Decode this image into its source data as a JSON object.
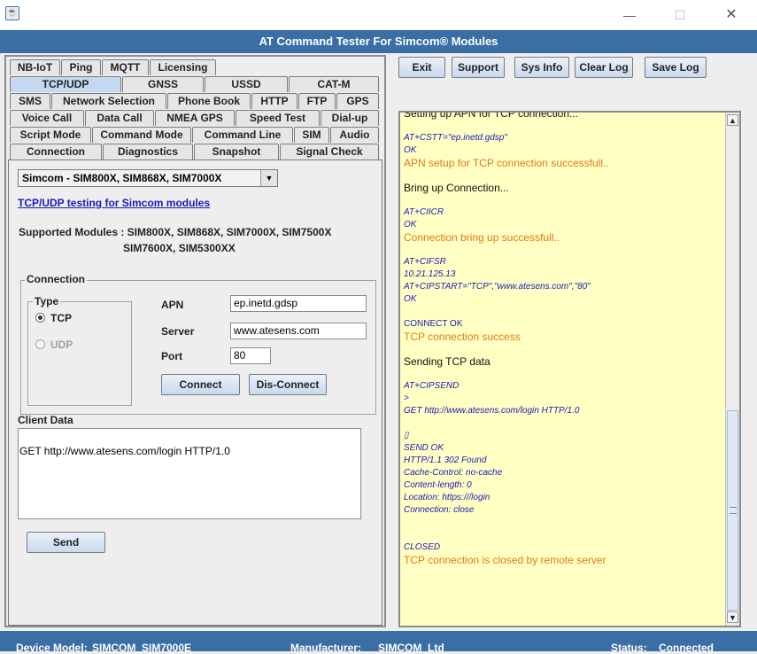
{
  "window": {
    "title": "AT Command Tester For Simcom® Modules",
    "minimize_glyph": "—",
    "maximize_glyph": "☐",
    "close_glyph": "✕"
  },
  "tabs": {
    "row1": [
      "NB-IoT",
      "Ping",
      "MQTT",
      "Licensing"
    ],
    "row2": [
      "TCP/UDP",
      "GNSS",
      "USSD",
      "CAT-M"
    ],
    "row3": [
      "SMS",
      "Network Selection",
      "Phone Book",
      "HTTP",
      "FTP",
      "GPS"
    ],
    "row4": [
      "Voice Call",
      "Data Call",
      "NMEA GPS",
      "Speed Test",
      "Dial-up"
    ],
    "row5": [
      "Script Mode",
      "Command Mode",
      "Command Line",
      "SIM",
      "Audio"
    ],
    "row6": [
      "Connection",
      "Diagnostics",
      "Snapshot",
      "Signal Check"
    ],
    "selected": "TCP/UDP"
  },
  "module_select": {
    "value": "Simcom - SIM800X, SIM868X, SIM7000X",
    "arrow": "▼"
  },
  "tcp_link": "TCP/UDP testing for Simcom modules",
  "supported": {
    "line1": "Supported Modules : SIM800X, SIM868X, SIM7000X, SIM7500X",
    "line2": "SIM7600X, SIM5300XX"
  },
  "connection": {
    "title": "Connection",
    "type_title": "Type",
    "radio_tcp": "TCP",
    "radio_udp": "UDP",
    "apn_label": "APN",
    "apn_value": "ep.inetd.gdsp",
    "server_label": "Server",
    "server_value": "www.atesens.com",
    "port_label": "Port",
    "port_value": "80",
    "connect_button": "Connect",
    "disconnect_button": "Dis-Connect"
  },
  "client_data": {
    "label": "Client Data",
    "value": "GET http://www.atesens.com/login HTTP/1.0",
    "send_button": "Send"
  },
  "toolbar": {
    "exit": "Exit",
    "support": "Support",
    "sysinfo": "Sys Info",
    "clearlog": "Clear Log",
    "savelog": "Save Log"
  },
  "log": {
    "lines": [
      {
        "t": "Setting up APN for TCP connection...",
        "s": "black"
      },
      {
        "t": "",
        "s": "black"
      },
      {
        "t": "AT+CSTT=\"ep.inetd.gdsp\"",
        "s": "cmd"
      },
      {
        "t": "OK",
        "s": "cmd"
      },
      {
        "t": "APN setup for TCP connection successfull..",
        "s": "orange"
      },
      {
        "t": "",
        "s": "black"
      },
      {
        "t": "Bring up Connection...",
        "s": "black"
      },
      {
        "t": "",
        "s": "black"
      },
      {
        "t": "AT+CIICR",
        "s": "cmd"
      },
      {
        "t": "OK",
        "s": "cmd"
      },
      {
        "t": "Connection bring up successfull..",
        "s": "orange"
      },
      {
        "t": "",
        "s": "black"
      },
      {
        "t": "AT+CIFSR",
        "s": "cmd"
      },
      {
        "t": "10.21.125.13",
        "s": "cmd"
      },
      {
        "t": "AT+CIPSTART=\"TCP\",\"www.atesens.com\",\"80\"",
        "s": "cmd"
      },
      {
        "t": "OK",
        "s": "cmd"
      },
      {
        "t": "",
        "s": "black"
      },
      {
        "t": "CONNECT OK",
        "s": "cmd-plain"
      },
      {
        "t": "TCP connection success",
        "s": "orange"
      },
      {
        "t": "",
        "s": "black"
      },
      {
        "t": "Sending TCP data",
        "s": "black"
      },
      {
        "t": "",
        "s": "black"
      },
      {
        "t": "AT+CIPSEND",
        "s": "cmd"
      },
      {
        "t": ">",
        "s": "cmd"
      },
      {
        "t": "GET http://www.atesens.com/login HTTP/1.0",
        "s": "cmd"
      },
      {
        "t": "",
        "s": "black"
      },
      {
        "t": "▯",
        "s": "cmd"
      },
      {
        "t": "SEND OK",
        "s": "cmd"
      },
      {
        "t": "HTTP/1.1 302 Found",
        "s": "cmd"
      },
      {
        "t": "Cache-Control: no-cache",
        "s": "cmd"
      },
      {
        "t": "Content-length: 0",
        "s": "cmd"
      },
      {
        "t": "Location: https:///login",
        "s": "cmd"
      },
      {
        "t": "Connection: close",
        "s": "cmd"
      },
      {
        "t": "",
        "s": "black"
      },
      {
        "t": "",
        "s": "black"
      },
      {
        "t": "CLOSED",
        "s": "cmd"
      },
      {
        "t": "TCP connection is closed by remote server",
        "s": "orange"
      }
    ]
  },
  "status": {
    "device_label": "Device Model:",
    "device_value": "SIMCOM_SIM7000E",
    "manufacturer_label": "Manufacturer:",
    "manufacturer_value": "SIMCOM_Ltd",
    "status_label": "Status:",
    "status_value": "Connected"
  },
  "colors": {
    "title_bar": "#3a6ea5",
    "log_background": "#ffffc4",
    "log_command": "#1a1ab8",
    "log_result": "#e07a18",
    "selected_tab": "#c4d8f0"
  }
}
